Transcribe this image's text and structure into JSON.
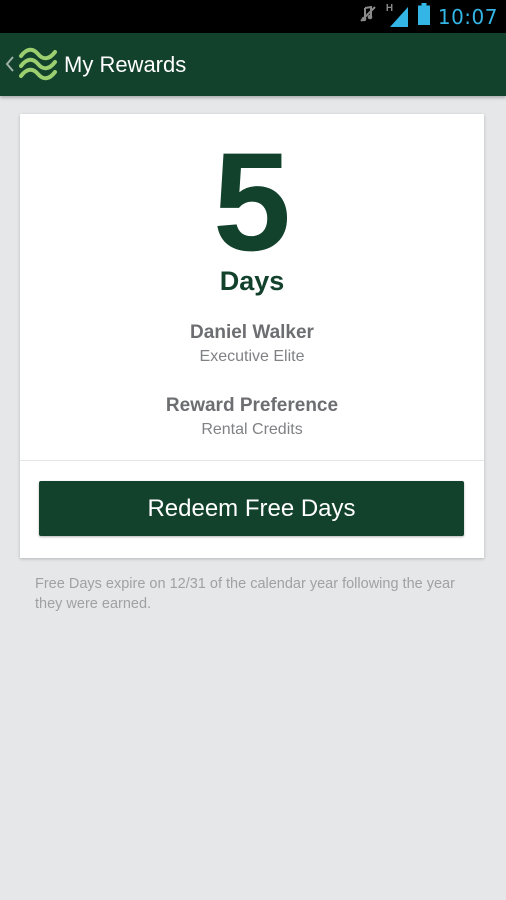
{
  "status_bar": {
    "time": "10:07",
    "network_type": "H",
    "icons": [
      "mute-icon",
      "signal-icon",
      "battery-icon"
    ],
    "time_color": "#33b5e5"
  },
  "app_bar": {
    "title": "My Rewards",
    "background_color": "#12412c",
    "logo_color": "#9ccf6f"
  },
  "rewards": {
    "free_days_count": "5",
    "free_days_unit": "Days",
    "member_name": "Daniel Walker",
    "member_tier": "Executive Elite",
    "preference_title": "Reward Preference",
    "preference_value": "Rental Credits",
    "redeem_label": "Redeem Free Days"
  },
  "footnote": "Free Days expire on 12/31 of the calendar year following the year they were earned."
}
